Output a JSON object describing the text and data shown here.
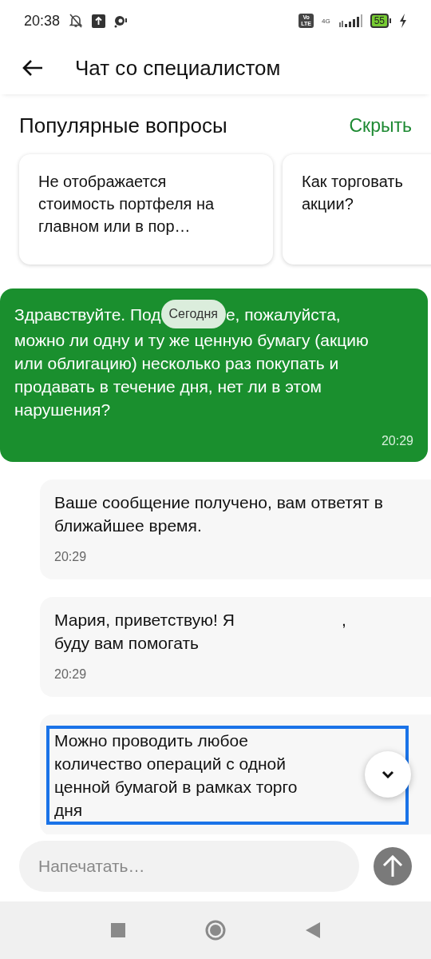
{
  "status_bar": {
    "time": "20:38",
    "volte": [
      "Vo",
      "LTE"
    ],
    "network": "4G",
    "battery": "55"
  },
  "header": {
    "title": "Чат со специалистом"
  },
  "popular": {
    "title": "Популярные вопросы",
    "hide_action": "Скрыть",
    "questions": [
      {
        "text": "Не отображается стоимость портфеля на главном или в пор…"
      },
      {
        "text": "Как торговать акции?"
      }
    ]
  },
  "messages": [
    {
      "kind": "outgoing",
      "text_before": "Здравствуйте. Под",
      "date_chip": "Сегодня",
      "text_after": "е, пожалуйста,",
      "text_rest": "можно ли одну и ту же ценную бумагу (акцию или облигацию) несколько раз покупать и продавать в течение дня, нет ли в этом нарушения?",
      "time": "20:29",
      "highlighted": false
    },
    {
      "kind": "incoming",
      "text": "Ваше сообщение получено, вам ответят в ближайшее время.",
      "time": "20:29",
      "highlighted": false
    },
    {
      "kind": "incoming",
      "text": "Мария, приветствую! Я                       ,\nбуду вам помогать",
      "time": "20:29",
      "highlighted": false
    },
    {
      "kind": "incoming",
      "text": "Можно проводить любое\nколичество операций с одной\nценной бумагой в рамках торго\nдня",
      "highlighted": true
    }
  ],
  "composer": {
    "placeholder": "Напечатать…"
  }
}
